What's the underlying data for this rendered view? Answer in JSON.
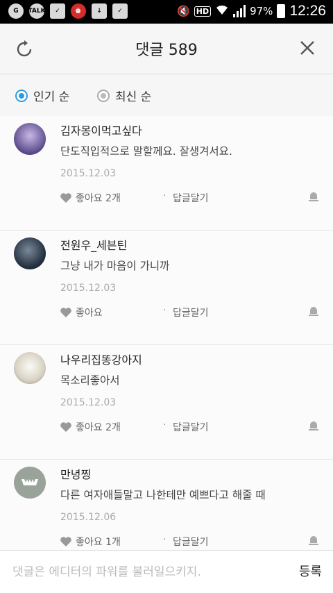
{
  "status_bar": {
    "battery": "97%",
    "time": "12:26",
    "hd": "HD",
    "talk": "TALK"
  },
  "header": {
    "title": "댓글 589"
  },
  "sort": {
    "popular": "인기 순",
    "latest": "최신 순"
  },
  "comments": [
    {
      "author": "김자몽이먹고싶다",
      "text": "단도직입적으로 말할께요. 잘생겨서요.",
      "date": "2015.12.03",
      "likes": "좋아요 2개",
      "reply": "답글달기"
    },
    {
      "author": "전원우_세븐틴",
      "text": "그냥 내가 마음이 가니까",
      "date": "2015.12.03",
      "likes": "좋아요",
      "reply": "답글달기"
    },
    {
      "author": "나우리집똥강아지",
      "text": "목소리좋아서",
      "date": "2015.12.03",
      "likes": "좋아요 2개",
      "reply": "답글달기"
    },
    {
      "author": "만녕찡",
      "text": "다른 여자애들말고 나한테만 예쁘다고 해줄 때",
      "date": "2015.12.06",
      "likes": "좋아요 1개",
      "reply": "답글달기"
    }
  ],
  "composer": {
    "placeholder": "댓글은 에디터의 파워를 불러일으키지.",
    "submit": "등록"
  }
}
